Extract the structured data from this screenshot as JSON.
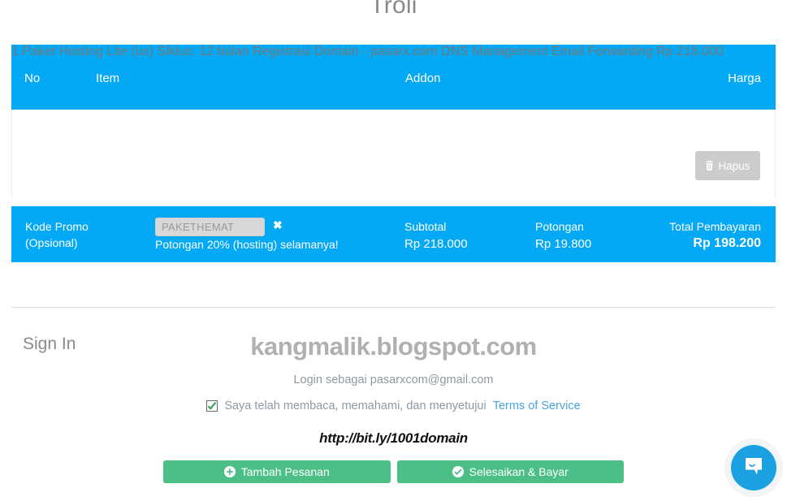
{
  "page": {
    "title": "Troli"
  },
  "cart": {
    "columns": {
      "no": "No",
      "item": "Item",
      "addon": "Addon",
      "harga": "Harga"
    },
    "rows": [
      {
        "no": "1",
        "name": "Paket Hosting Lite (us)",
        "cycle": "Siklus: 12 bulan",
        "domain": "Registrasi Domain - pasarx.com",
        "addons": [
          "DNS Management",
          "Email Forwarding"
        ],
        "price": "Rp 218.000",
        "delete_label": "Hapus",
        "delete_icon": "trash-icon"
      }
    ]
  },
  "promo": {
    "label_line1": "Kode Promo",
    "label_line2": "(Opsional)",
    "code_value": "PAKETHEMAT",
    "code_placeholder": "Kode Promo",
    "clear_icon": "close-x-icon",
    "note": "Potongan 20% (hosting) selamanya!"
  },
  "summary": {
    "subtotal_label": "Subtotal",
    "subtotal_value": "Rp 218.000",
    "discount_label": "Potongan",
    "discount_value": "Rp 19.800",
    "total_label": "Total Pembayaran",
    "total_value": "Rp 198.200"
  },
  "signin": {
    "heading": "Sign In",
    "login_as": "Login sebagai pasarxcom@gmail.com",
    "tos_text": "Saya telah membaca, memahami, dan menyetujui",
    "tos_link": "Terms of Service",
    "tos_checked": true
  },
  "watermarks": {
    "site": "kangmalik.blogspot.com",
    "shortlink": "http://bit.ly/1001domain"
  },
  "actions": {
    "add_order_label": "Tambah Pesanan",
    "add_order_icon": "plus-circle-icon",
    "checkout_label": "Selesaikan & Bayar",
    "checkout_icon": "check-circle-icon"
  },
  "chat": {
    "launcher_icon": "chat-bubble-smile-icon"
  },
  "colors": {
    "accent_blue": "#03a9f4",
    "green": "#4cbf86",
    "link_blue": "#4aa3df",
    "muted_text": "#7b8a95",
    "disabled_grey": "#cccccc"
  }
}
